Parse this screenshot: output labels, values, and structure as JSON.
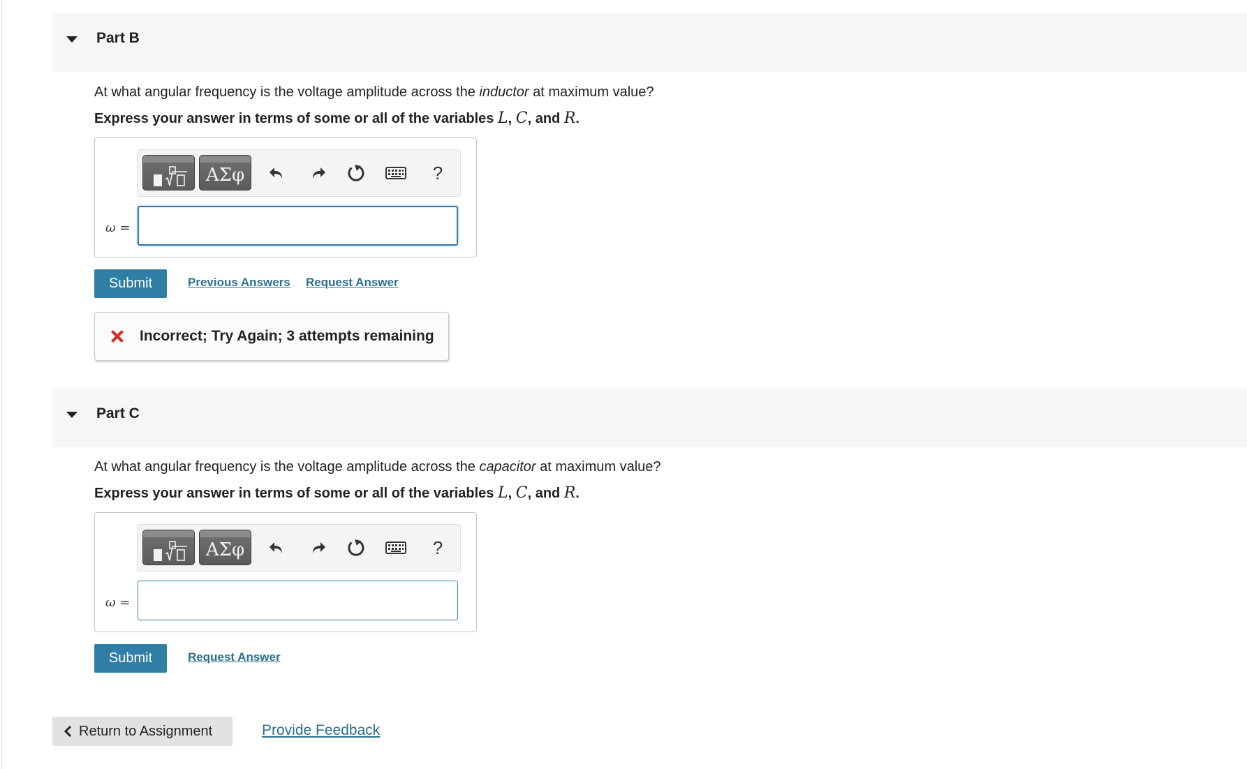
{
  "part_b": {
    "title": "Part B",
    "question_pre": "At what angular frequency is the voltage amplitude across the ",
    "question_em": "inductor",
    "question_post": " at maximum value?",
    "instruction_pre": "Express your answer in terms of some or all of the variables ",
    "var_1": "L",
    "sep_1": ", ",
    "var_2": "C",
    "sep_2": ", and ",
    "var_3": "R",
    "instruction_end": ".",
    "toolbar": {
      "greek_label": "ΑΣφ",
      "help_label": "?"
    },
    "var_symbol": "ω",
    "var_equals": " =",
    "answer_value": "",
    "submit_label": "Submit",
    "previous_answers_label": "Previous Answers",
    "request_answer_label": "Request Answer",
    "feedback_text": "Incorrect; Try Again; 3 attempts remaining",
    "feedback_color": "#d0312d"
  },
  "part_c": {
    "title": "Part C",
    "question_pre": "At what angular frequency is the voltage amplitude across the ",
    "question_em": "capacitor",
    "question_post": " at maximum value?",
    "instruction_pre": "Express your answer in terms of some or all of the variables ",
    "var_1": "L",
    "sep_1": ", ",
    "var_2": "C",
    "sep_2": ", and ",
    "var_3": "R",
    "instruction_end": ".",
    "toolbar": {
      "greek_label": "ΑΣφ",
      "help_label": "?"
    },
    "var_symbol": "ω",
    "var_equals": " =",
    "answer_value": "",
    "submit_label": "Submit",
    "request_answer_label": "Request Answer"
  },
  "footer": {
    "return_label": "Return to Assignment",
    "feedback_link_label": "Provide Feedback"
  },
  "colors": {
    "accent": "#2f7ea5",
    "link": "#2c6f92",
    "error": "#d0312d",
    "header_bg": "#f6f6f6"
  },
  "icons": [
    "caret-down-icon",
    "template-icon",
    "greek-icon",
    "undo-icon",
    "redo-icon",
    "reset-icon",
    "keyboard-icon",
    "help-icon",
    "error-x-icon",
    "chevron-left-icon"
  ]
}
